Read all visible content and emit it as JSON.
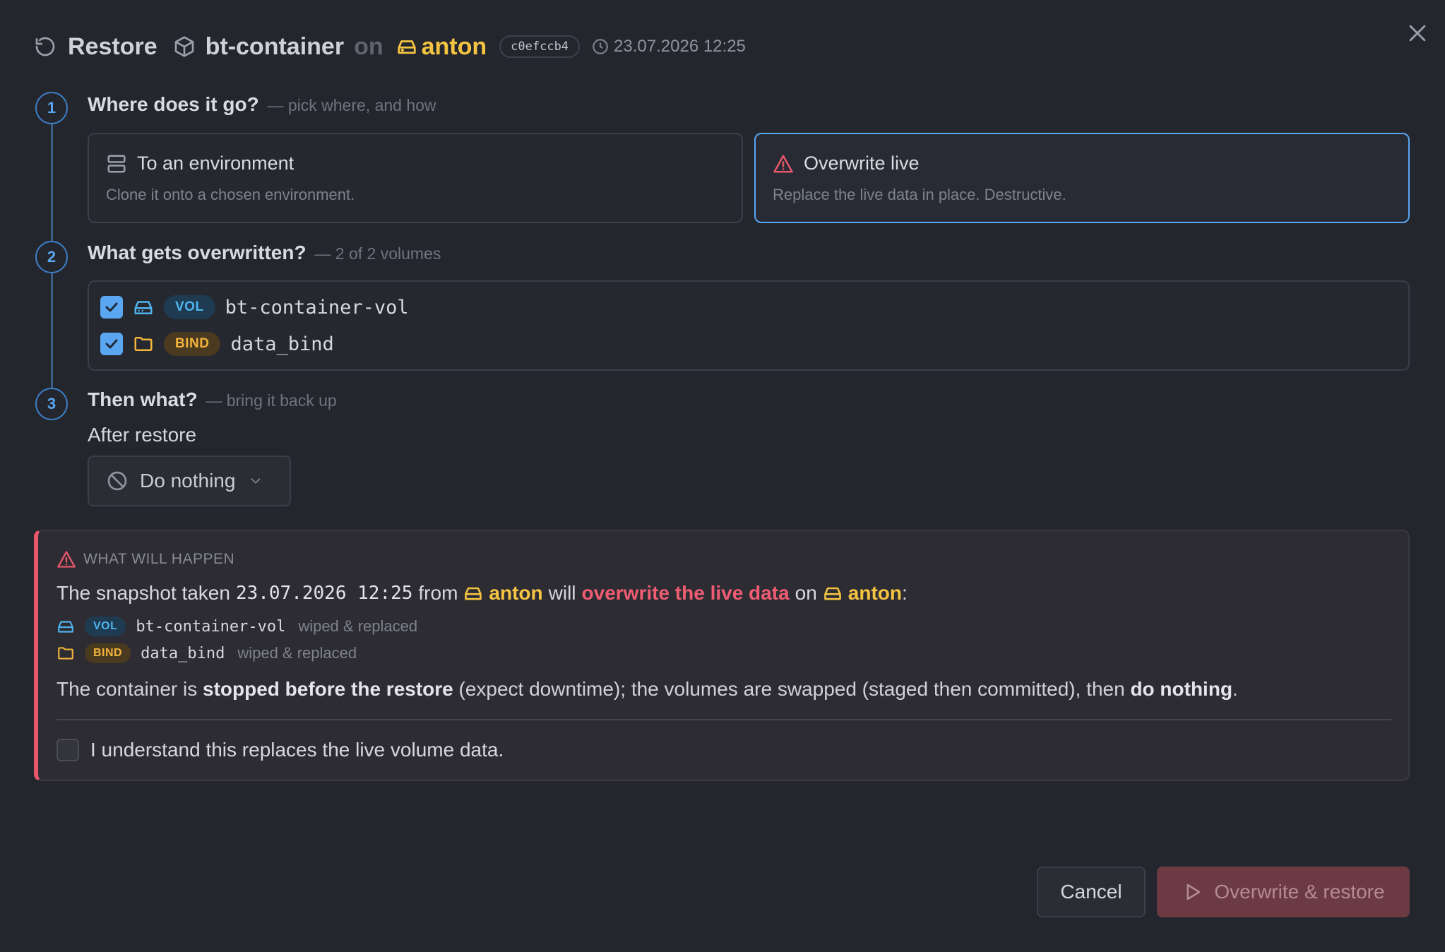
{
  "header": {
    "title": "Restore",
    "container": "bt-container",
    "on": "on",
    "host": "anton",
    "hash": "c0efccb4",
    "datetime": "23.07.2026 12:25"
  },
  "steps": [
    {
      "num": "1",
      "title": "Where does it go?",
      "sub": "— pick where, and how"
    },
    {
      "num": "2",
      "title": "What gets overwritten?",
      "sub": "— 2 of 2 volumes"
    },
    {
      "num": "3",
      "title": "Then what?",
      "sub": "— bring it back up"
    }
  ],
  "options": [
    {
      "title": "To an environment",
      "desc": "Clone it onto a chosen environment.",
      "selected": false,
      "icon": "server-icon"
    },
    {
      "title": "Overwrite live",
      "desc": "Replace the live data in place. Destructive.",
      "selected": true,
      "icon": "warning-icon"
    }
  ],
  "volumes": [
    {
      "checked": true,
      "badge": "VOL",
      "name": "bt-container-vol",
      "icon": "drive-icon"
    },
    {
      "checked": true,
      "badge": "BIND",
      "name": "data_bind",
      "icon": "folder-icon"
    }
  ],
  "after": {
    "label": "After restore",
    "value": "Do nothing"
  },
  "warning": {
    "heading": "WHAT WILL HAPPEN",
    "s1": "The snapshot taken",
    "date": "23.07.2026 12:25",
    "s2": "from",
    "host1": "anton",
    "s3": "will",
    "danger": "overwrite the live data",
    "s4": "on",
    "host2": "anton",
    "colon": ":",
    "rows": [
      {
        "badge": "VOL",
        "name": "bt-container-vol",
        "status": "wiped & replaced"
      },
      {
        "badge": "BIND",
        "name": "data_bind",
        "status": "wiped & replaced"
      }
    ],
    "summary_1": "The container is ",
    "summary_b1": "stopped before the restore",
    "summary_2": " (expect downtime); the volumes are swapped (staged then committed), then ",
    "summary_b2": "do nothing",
    "summary_3": ".",
    "ack": "I understand this replaces the live volume data."
  },
  "buttons": {
    "cancel": "Cancel",
    "primary": "Overwrite & restore"
  },
  "colors": {
    "accent": "#5aa6f0",
    "danger": "#e8566a",
    "host": "#f5c542",
    "vol_badge": "#4fb5ef",
    "bind_badge": "#f3b43c"
  }
}
